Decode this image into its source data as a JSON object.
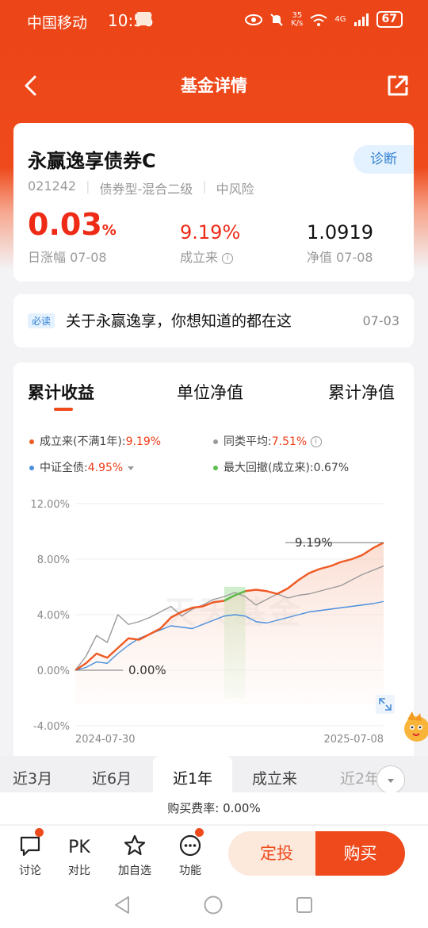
{
  "status": {
    "carrier": "中国移动",
    "time": "10:56",
    "net_speed_top": "35",
    "net_speed_unit": "K/s",
    "signal": "4G",
    "battery": "67"
  },
  "nav": {
    "title": "基金详情"
  },
  "fund": {
    "name": "永赢逸享债券C",
    "diagnose": "诊断",
    "code": "021242",
    "type": "债券型-混合二级",
    "risk": "中风险",
    "day_change": "0.03",
    "day_change_unit": "%",
    "day_change_label": "日涨幅 07-08",
    "since_inception": "9.19%",
    "since_inception_label": "成立来",
    "nav_value": "1.0919",
    "nav_label": "净值 07-08"
  },
  "notice": {
    "tag": "必读",
    "text": "关于永赢逸享，你想知道的都在这",
    "date": "07-03"
  },
  "chart_tabs": [
    "累计收益",
    "单位净值",
    "累计净值"
  ],
  "legend": {
    "fund_label": "成立来(不满1年):",
    "fund_value": "9.19%",
    "peer_label": "同类平均:",
    "peer_value": "7.51%",
    "index_label": "中证全债:",
    "index_value": "4.95%",
    "drawdown_label": "最大回撤(成立来):",
    "drawdown_value": "0.67%"
  },
  "colors": {
    "fund": "#ee5a24",
    "peer": "#9a9a9a",
    "index": "#4a8fdc",
    "drawdown": "#5cbf4f",
    "accent": "#ee4a1c"
  },
  "chart_data": {
    "type": "line",
    "x_start": "2024-07-30",
    "x_end": "2025-07-08",
    "y_ticks": [
      "12.00%",
      "8.00%",
      "4.00%",
      "0.00%",
      "-4.00%"
    ],
    "ylim": [
      -4,
      12
    ],
    "annotations": [
      "9.19%",
      "0.00%"
    ],
    "watermark": "天天基金",
    "series": [
      {
        "name": "成立来(不满1年)",
        "values": [
          0,
          0.5,
          1.2,
          0.9,
          1.6,
          2.3,
          2.2,
          2.6,
          3.0,
          3.8,
          4.2,
          4.5,
          4.6,
          4.9,
          5.0,
          5.4,
          5.7,
          5.8,
          5.7,
          5.5,
          5.9,
          6.5,
          7.0,
          7.3,
          7.5,
          7.8,
          8.0,
          8.3,
          8.8,
          9.19
        ]
      },
      {
        "name": "同类平均",
        "values": [
          0,
          1.0,
          2.5,
          2.0,
          4.0,
          3.3,
          3.5,
          3.8,
          4.2,
          4.6,
          3.9,
          4.4,
          4.7,
          5.1,
          5.3,
          5.6,
          5.3,
          4.7,
          5.1,
          5.5,
          5.2,
          5.4,
          5.5,
          5.7,
          5.9,
          6.1,
          6.5,
          6.9,
          7.2,
          7.51
        ]
      },
      {
        "name": "中证全债",
        "values": [
          0,
          0.2,
          0.6,
          0.5,
          1.2,
          1.8,
          2.3,
          2.6,
          2.9,
          3.2,
          3.1,
          3.0,
          3.3,
          3.6,
          3.9,
          4.0,
          3.9,
          3.5,
          3.4,
          3.6,
          3.8,
          4.0,
          4.2,
          4.3,
          4.4,
          4.5,
          4.6,
          4.7,
          4.8,
          4.95
        ]
      }
    ]
  },
  "ranges": [
    "近3月",
    "近6月",
    "近1年",
    "成立来",
    "近2年"
  ],
  "fee": "购买费率: 0.00%",
  "bottom": {
    "discuss": "讨论",
    "compare_icon": "PK",
    "compare": "对比",
    "watchlist": "加自选",
    "functions": "功能",
    "dingtou": "定投",
    "buy": "购买"
  }
}
